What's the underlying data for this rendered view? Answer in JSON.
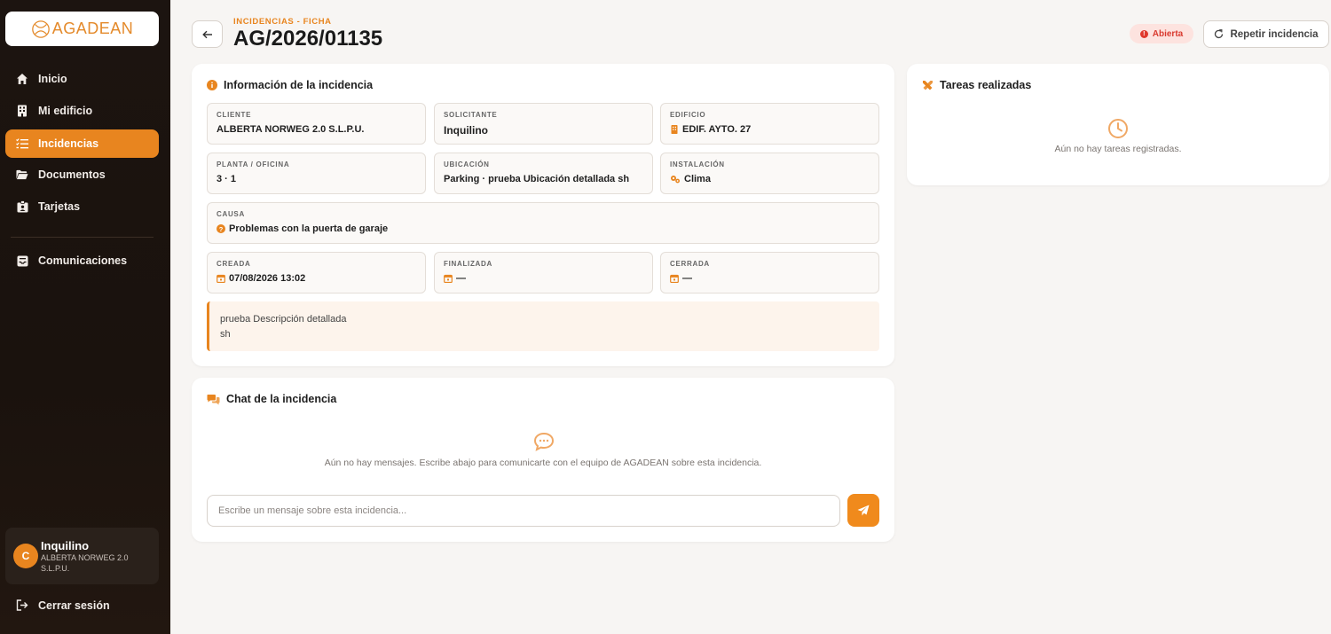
{
  "brand": {
    "logo_text": "AGADEAN",
    "accent": "#e8851f"
  },
  "nav": {
    "items": [
      {
        "label": "Inicio",
        "icon": "home-icon"
      },
      {
        "label": "Mi edificio",
        "icon": "building-icon"
      },
      {
        "label": "Incidencias",
        "icon": "list-icon",
        "active": true
      },
      {
        "label": "Documentos",
        "icon": "folder-icon"
      },
      {
        "label": "Tarjetas",
        "icon": "id-card-icon"
      },
      {
        "label": "Comunicaciones",
        "icon": "inbox-icon"
      }
    ]
  },
  "user": {
    "initial": "C",
    "name": "Inquilino",
    "company": "ALBERTA NORWEG 2.0 S.L.P.U."
  },
  "logout_label": "Cerrar sesión",
  "header": {
    "subtitle": "INCIDENCIAS - FICHA",
    "title": "AG/2026/01135",
    "status": "Abierta",
    "repeat_label": "Repetir incidencia"
  },
  "info": {
    "title": "Información de la incidencia",
    "cliente": {
      "label": "CLIENTE",
      "value": "ALBERTA NORWEG 2.0 S.L.P.U."
    },
    "solicitante": {
      "label": "SOLICITANTE",
      "value": "Inquilino"
    },
    "edificio": {
      "label": "EDIFICIO",
      "value": "EDIF. AYTO. 27"
    },
    "planta": {
      "label": "PLANTA / OFICINA",
      "value": "3 · 1"
    },
    "ubicacion": {
      "label": "UBICACIÓN",
      "value": "Parking · prueba Ubicación detallada sh"
    },
    "instalacion": {
      "label": "INSTALACIÓN",
      "value": "Clima"
    },
    "causa": {
      "label": "CAUSA",
      "value": "Problemas con la puerta de garaje"
    },
    "creada": {
      "label": "CREADA",
      "value": "07/08/2026 13:02"
    },
    "finalizada": {
      "label": "FINALIZADA",
      "value": "—"
    },
    "cerrada": {
      "label": "CERRADA",
      "value": "—"
    },
    "description": "prueba Descripción detallada\n sh"
  },
  "tasks": {
    "title": "Tareas realizadas",
    "empty": "Aún no hay tareas registradas."
  },
  "chat": {
    "title": "Chat de la incidencia",
    "empty": "Aún no hay mensajes. Escribe abajo para comunicarte con el equipo de AGADEAN sobre esta incidencia.",
    "placeholder": "Escribe un mensaje sobre esta incidencia..."
  }
}
